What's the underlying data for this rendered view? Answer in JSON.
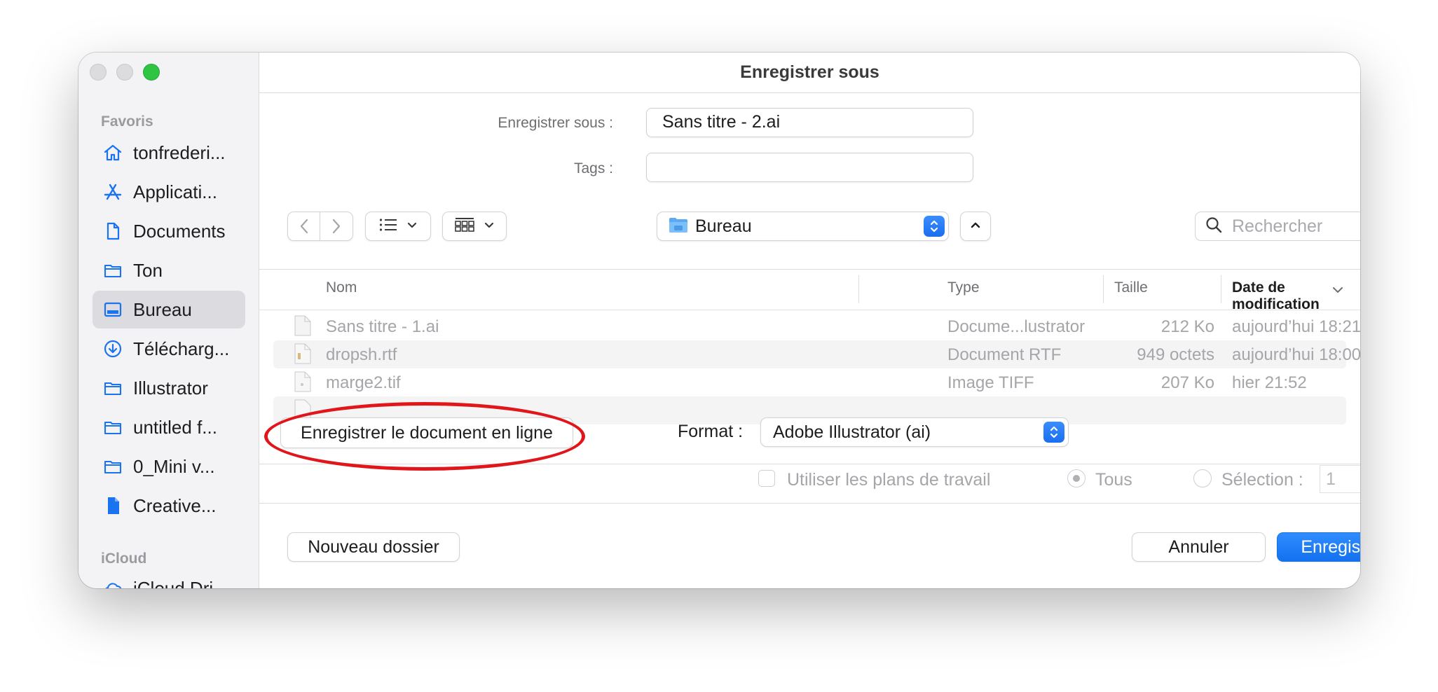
{
  "window": {
    "title": "Enregistrer sous"
  },
  "sidebar": {
    "favorites_label": "Favoris",
    "icloud_label": "iCloud",
    "items": [
      {
        "label": "tonfrederi...",
        "icon": "home-icon"
      },
      {
        "label": "Applicati...",
        "icon": "applications-icon"
      },
      {
        "label": "Documents",
        "icon": "document-icon"
      },
      {
        "label": "Ton",
        "icon": "folder-icon"
      },
      {
        "label": "Bureau",
        "icon": "desktop-icon",
        "active": true
      },
      {
        "label": "Télécharg...",
        "icon": "download-icon"
      },
      {
        "label": "Illustrator",
        "icon": "folder-icon"
      },
      {
        "label": "untitled f...",
        "icon": "folder-icon"
      },
      {
        "label": "0_Mini v...",
        "icon": "folder-icon"
      },
      {
        "label": "Creative...",
        "icon": "file-icon"
      }
    ],
    "icloud_items": [
      {
        "label": "iCloud Dri...",
        "icon": "cloud-icon"
      }
    ]
  },
  "form": {
    "save_as_label": "Enregistrer sous :",
    "save_as_value": "Sans titre - 2.ai",
    "tags_label": "Tags :",
    "tags_value": ""
  },
  "toolbar": {
    "location": "Bureau",
    "search_placeholder": "Rechercher"
  },
  "file_list": {
    "columns": [
      "Nom",
      "Type",
      "Taille",
      "Date de modification"
    ],
    "sorted_column": "Date de modification",
    "rows": [
      {
        "name": "Sans titre - 1.ai",
        "type": "Docume...lustrator",
        "size": "212 Ko",
        "date": "aujourd’hui 18:21"
      },
      {
        "name": "dropsh.rtf",
        "type": "Document RTF",
        "size": "949 octets",
        "date": "aujourd’hui 18:00"
      },
      {
        "name": "marge2.tif",
        "type": "Image TIFF",
        "size": "207 Ko",
        "date": "hier 21:52"
      },
      {
        "name": "",
        "type": "",
        "size": "",
        "date": ""
      }
    ]
  },
  "options": {
    "online_button": "Enregistrer le document en ligne",
    "format_label": "Format :",
    "format_value": "Adobe Illustrator (ai)",
    "use_artboards_label": "Utiliser les plans de travail",
    "all_label": "Tous",
    "selection_label": "Sélection :",
    "selection_value": "1"
  },
  "buttons": {
    "new_folder": "Nouveau dossier",
    "cancel": "Annuler",
    "save": "Enregistrer"
  },
  "colors": {
    "accent": "#1a73f0",
    "annotation": "#e0161b"
  }
}
